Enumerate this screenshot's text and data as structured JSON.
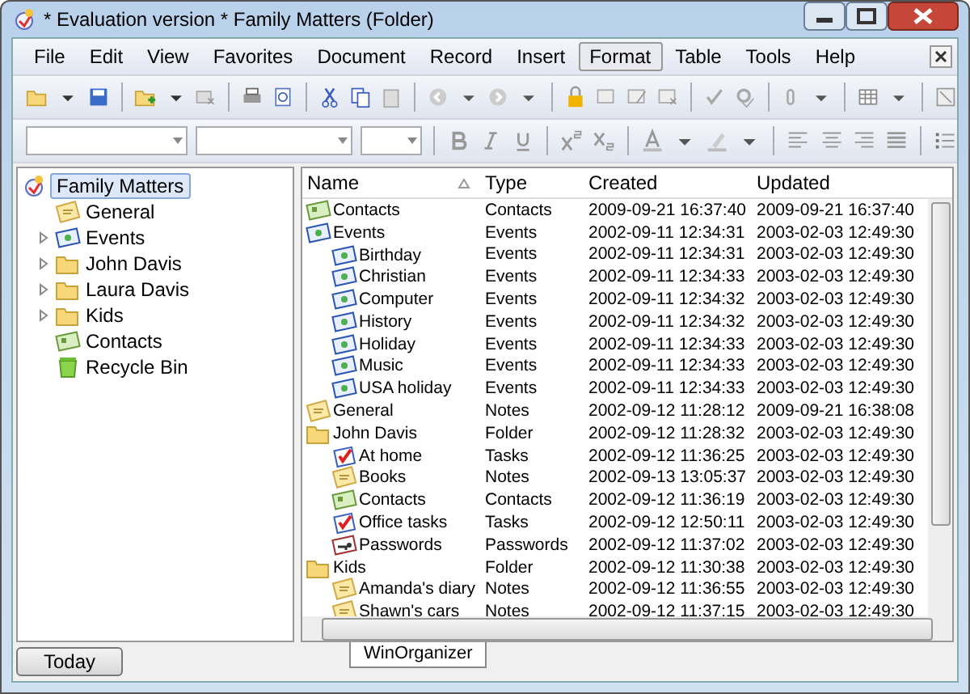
{
  "window": {
    "title": "* Evaluation version * Family Matters (Folder)"
  },
  "menu": [
    {
      "label": "File",
      "selected": false
    },
    {
      "label": "Edit",
      "selected": false
    },
    {
      "label": "View",
      "selected": false
    },
    {
      "label": "Favorites",
      "selected": false
    },
    {
      "label": "Document",
      "selected": false
    },
    {
      "label": "Record",
      "selected": false
    },
    {
      "label": "Insert",
      "selected": false
    },
    {
      "label": "Format",
      "selected": true
    },
    {
      "label": "Table",
      "selected": false
    },
    {
      "label": "Tools",
      "selected": false
    },
    {
      "label": "Help",
      "selected": false
    }
  ],
  "tree": {
    "root": {
      "label": "Family Matters",
      "selected": true
    },
    "items": [
      {
        "label": "General",
        "kind": "notes",
        "expandable": false
      },
      {
        "label": "Events",
        "kind": "events",
        "expandable": true
      },
      {
        "label": "John Davis",
        "kind": "folder",
        "expandable": true
      },
      {
        "label": "Laura Davis",
        "kind": "folder",
        "expandable": true
      },
      {
        "label": "Kids",
        "kind": "folder",
        "expandable": true
      },
      {
        "label": "Contacts",
        "kind": "contacts",
        "expandable": false
      },
      {
        "label": "Recycle Bin",
        "kind": "bin",
        "expandable": false
      }
    ]
  },
  "table": {
    "columns": [
      "Name",
      "Type",
      "Created",
      "Updated"
    ],
    "rows": [
      {
        "name": "Contacts",
        "kind": "contacts",
        "type": "Contacts",
        "created": "2009-09-21 16:37:40",
        "updated": "2009-09-21 16:37:40",
        "children": []
      },
      {
        "name": "Events",
        "kind": "events",
        "type": "Events",
        "created": "2002-09-11 12:34:31",
        "updated": "2003-02-03 12:49:30",
        "children": [
          {
            "name": "Birthday",
            "kind": "events",
            "type": "Events",
            "created": "2002-09-11 12:34:31",
            "updated": "2003-02-03 12:49:30"
          },
          {
            "name": "Christian",
            "kind": "events",
            "type": "Events",
            "created": "2002-09-11 12:34:33",
            "updated": "2003-02-03 12:49:30"
          },
          {
            "name": "Computer",
            "kind": "events",
            "type": "Events",
            "created": "2002-09-11 12:34:32",
            "updated": "2003-02-03 12:49:30"
          },
          {
            "name": "History",
            "kind": "events",
            "type": "Events",
            "created": "2002-09-11 12:34:32",
            "updated": "2003-02-03 12:49:30"
          },
          {
            "name": "Holiday",
            "kind": "events",
            "type": "Events",
            "created": "2002-09-11 12:34:33",
            "updated": "2003-02-03 12:49:30"
          },
          {
            "name": "Music",
            "kind": "events",
            "type": "Events",
            "created": "2002-09-11 12:34:33",
            "updated": "2003-02-03 12:49:30"
          },
          {
            "name": "USA holiday",
            "kind": "events",
            "type": "Events",
            "created": "2002-09-11 12:34:33",
            "updated": "2003-02-03 12:49:30"
          }
        ]
      },
      {
        "name": "General",
        "kind": "notes",
        "type": "Notes",
        "created": "2002-09-12 11:28:12",
        "updated": "2009-09-21 16:38:08",
        "children": []
      },
      {
        "name": "John Davis",
        "kind": "folder",
        "type": "Folder",
        "created": "2002-09-12 11:28:32",
        "updated": "2003-02-03 12:49:30",
        "children": [
          {
            "name": "At home",
            "kind": "tasks",
            "type": "Tasks",
            "created": "2002-09-12 11:36:25",
            "updated": "2003-02-03 12:49:30"
          },
          {
            "name": "Books",
            "kind": "notes",
            "type": "Notes",
            "created": "2002-09-13 13:05:37",
            "updated": "2003-02-03 12:49:30"
          },
          {
            "name": "Contacts",
            "kind": "contacts",
            "type": "Contacts",
            "created": "2002-09-12 11:36:19",
            "updated": "2003-02-03 12:49:30"
          },
          {
            "name": "Office tasks",
            "kind": "tasks",
            "type": "Tasks",
            "created": "2002-09-12 12:50:11",
            "updated": "2003-02-03 12:49:30"
          },
          {
            "name": "Passwords",
            "kind": "passwords",
            "type": "Passwords",
            "created": "2002-09-12 11:37:02",
            "updated": "2003-02-03 12:49:30"
          }
        ]
      },
      {
        "name": "Kids",
        "kind": "folder",
        "type": "Folder",
        "created": "2002-09-12 11:30:38",
        "updated": "2003-02-03 12:49:30",
        "children": [
          {
            "name": "Amanda's diary",
            "kind": "notes",
            "type": "Notes",
            "created": "2002-09-12 11:36:55",
            "updated": "2003-02-03 12:49:30"
          },
          {
            "name": "Shawn's cars",
            "kind": "notes",
            "type": "Notes",
            "created": "2002-09-12 11:37:15",
            "updated": "2003-02-03 12:49:30"
          }
        ]
      }
    ]
  },
  "bottom": {
    "today_button": "Today",
    "tab": "WinOrganizer"
  }
}
